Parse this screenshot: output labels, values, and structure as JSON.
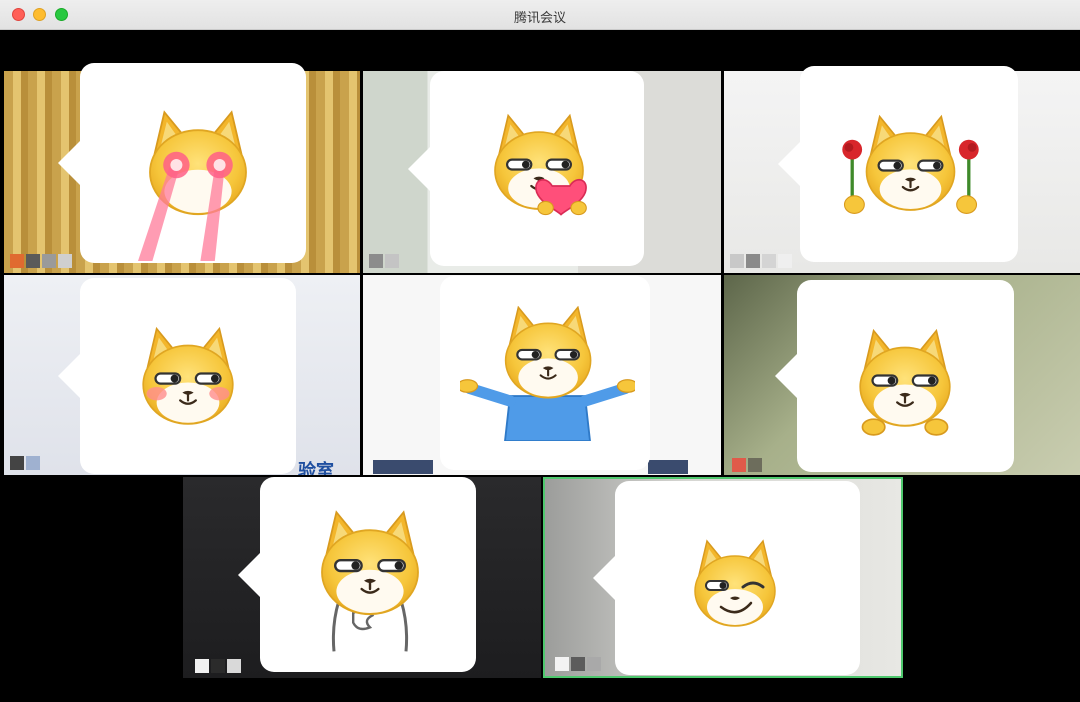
{
  "window": {
    "title": "腾讯会议"
  },
  "tiles": [
    {
      "id": "p1",
      "reaction": "laser-eyes"
    },
    {
      "id": "p2",
      "reaction": "heart"
    },
    {
      "id": "p3",
      "reaction": "roses"
    },
    {
      "id": "p4",
      "reaction": "blush",
      "background_text": "验室"
    },
    {
      "id": "p5",
      "reaction": "shrug"
    },
    {
      "id": "p6",
      "reaction": "peek"
    },
    {
      "id": "p7",
      "reaction": "thinking"
    },
    {
      "id": "p8",
      "reaction": "wink",
      "active_speaker": true
    }
  ],
  "colors": {
    "active_border": "#4fc86e",
    "doge_yellow": "#f6c63b",
    "bubble": "#ffffff"
  }
}
